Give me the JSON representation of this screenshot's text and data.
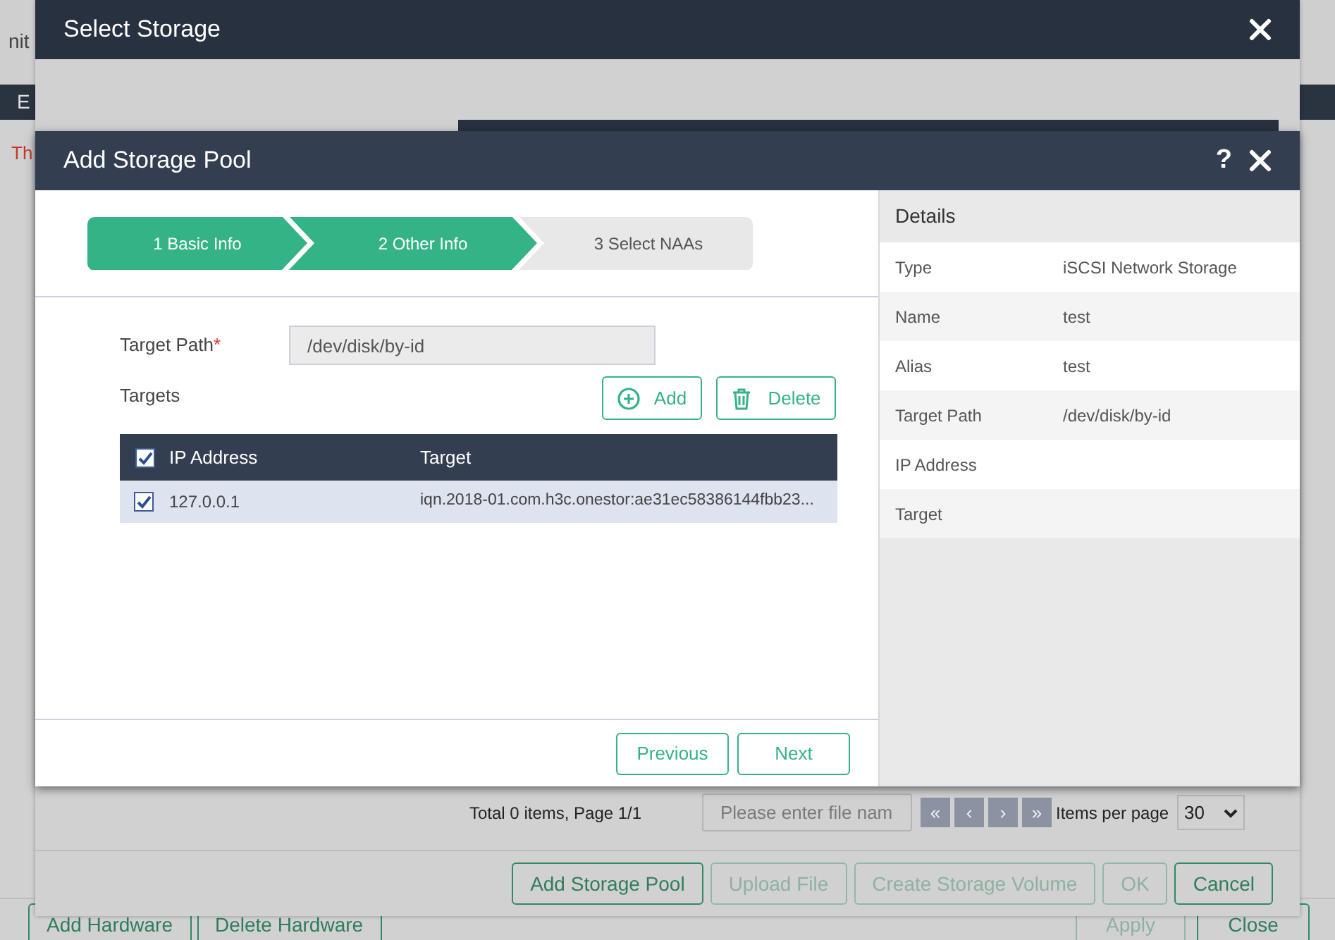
{
  "background_page": {
    "top_text": "nit",
    "bar_text": "E",
    "notice_text": "Th",
    "buttons": [
      {
        "label": "Add Hardware",
        "disabled": false
      },
      {
        "label": "Delete Hardware",
        "disabled": false
      }
    ],
    "right_buttons": [
      {
        "label": "Apply",
        "disabled": true
      },
      {
        "label": "Close",
        "disabled": false
      }
    ]
  },
  "select_storage": {
    "title": "Select Storage",
    "pagination": {
      "summary": "Total 0 items, Page 1/1",
      "search_placeholder": "Please enter file nam",
      "pager": [
        "«",
        "‹",
        "›",
        "»"
      ],
      "items_per_page_label": "Items per page",
      "items_per_page": "30"
    },
    "buttons": [
      {
        "label": "Add Storage Pool",
        "disabled": false
      },
      {
        "label": "Upload File",
        "disabled": true
      },
      {
        "label": "Create Storage Volume",
        "disabled": true
      },
      {
        "label": "OK",
        "disabled": true
      },
      {
        "label": "Cancel",
        "disabled": false
      }
    ]
  },
  "add_storage_pool": {
    "title": "Add Storage Pool",
    "help": "?",
    "steps": [
      {
        "label": "1 Basic Info",
        "active": true
      },
      {
        "label": "2 Other Info",
        "active": true
      },
      {
        "label": "3 Select NAAs",
        "active": false
      }
    ],
    "target_path": {
      "label": "Target Path",
      "required_mark": "*",
      "value": "/dev/disk/by-id"
    },
    "targets_label": "Targets",
    "add_button": "Add",
    "delete_button": "Delete",
    "table": {
      "all_checked": true,
      "columns": [
        "IP Address",
        "Target"
      ],
      "rows": [
        {
          "ip_address": "127.0.0.1",
          "target": "iqn.2018-01.com.h3c.onestor:ae31ec58386144fbb23...",
          "checked": true,
          "selected": true
        }
      ]
    },
    "previous_button": "Previous",
    "next_button": "Next",
    "details": {
      "title": "Details",
      "rows": [
        {
          "label": "Type",
          "value": "iSCSI Network Storage"
        },
        {
          "label": "Name",
          "value": "test"
        },
        {
          "label": "Alias",
          "value": "test"
        },
        {
          "label": "Target Path",
          "value": "/dev/disk/by-id"
        },
        {
          "label": "IP Address"
        },
        {
          "label": "Target"
        }
      ]
    }
  }
}
